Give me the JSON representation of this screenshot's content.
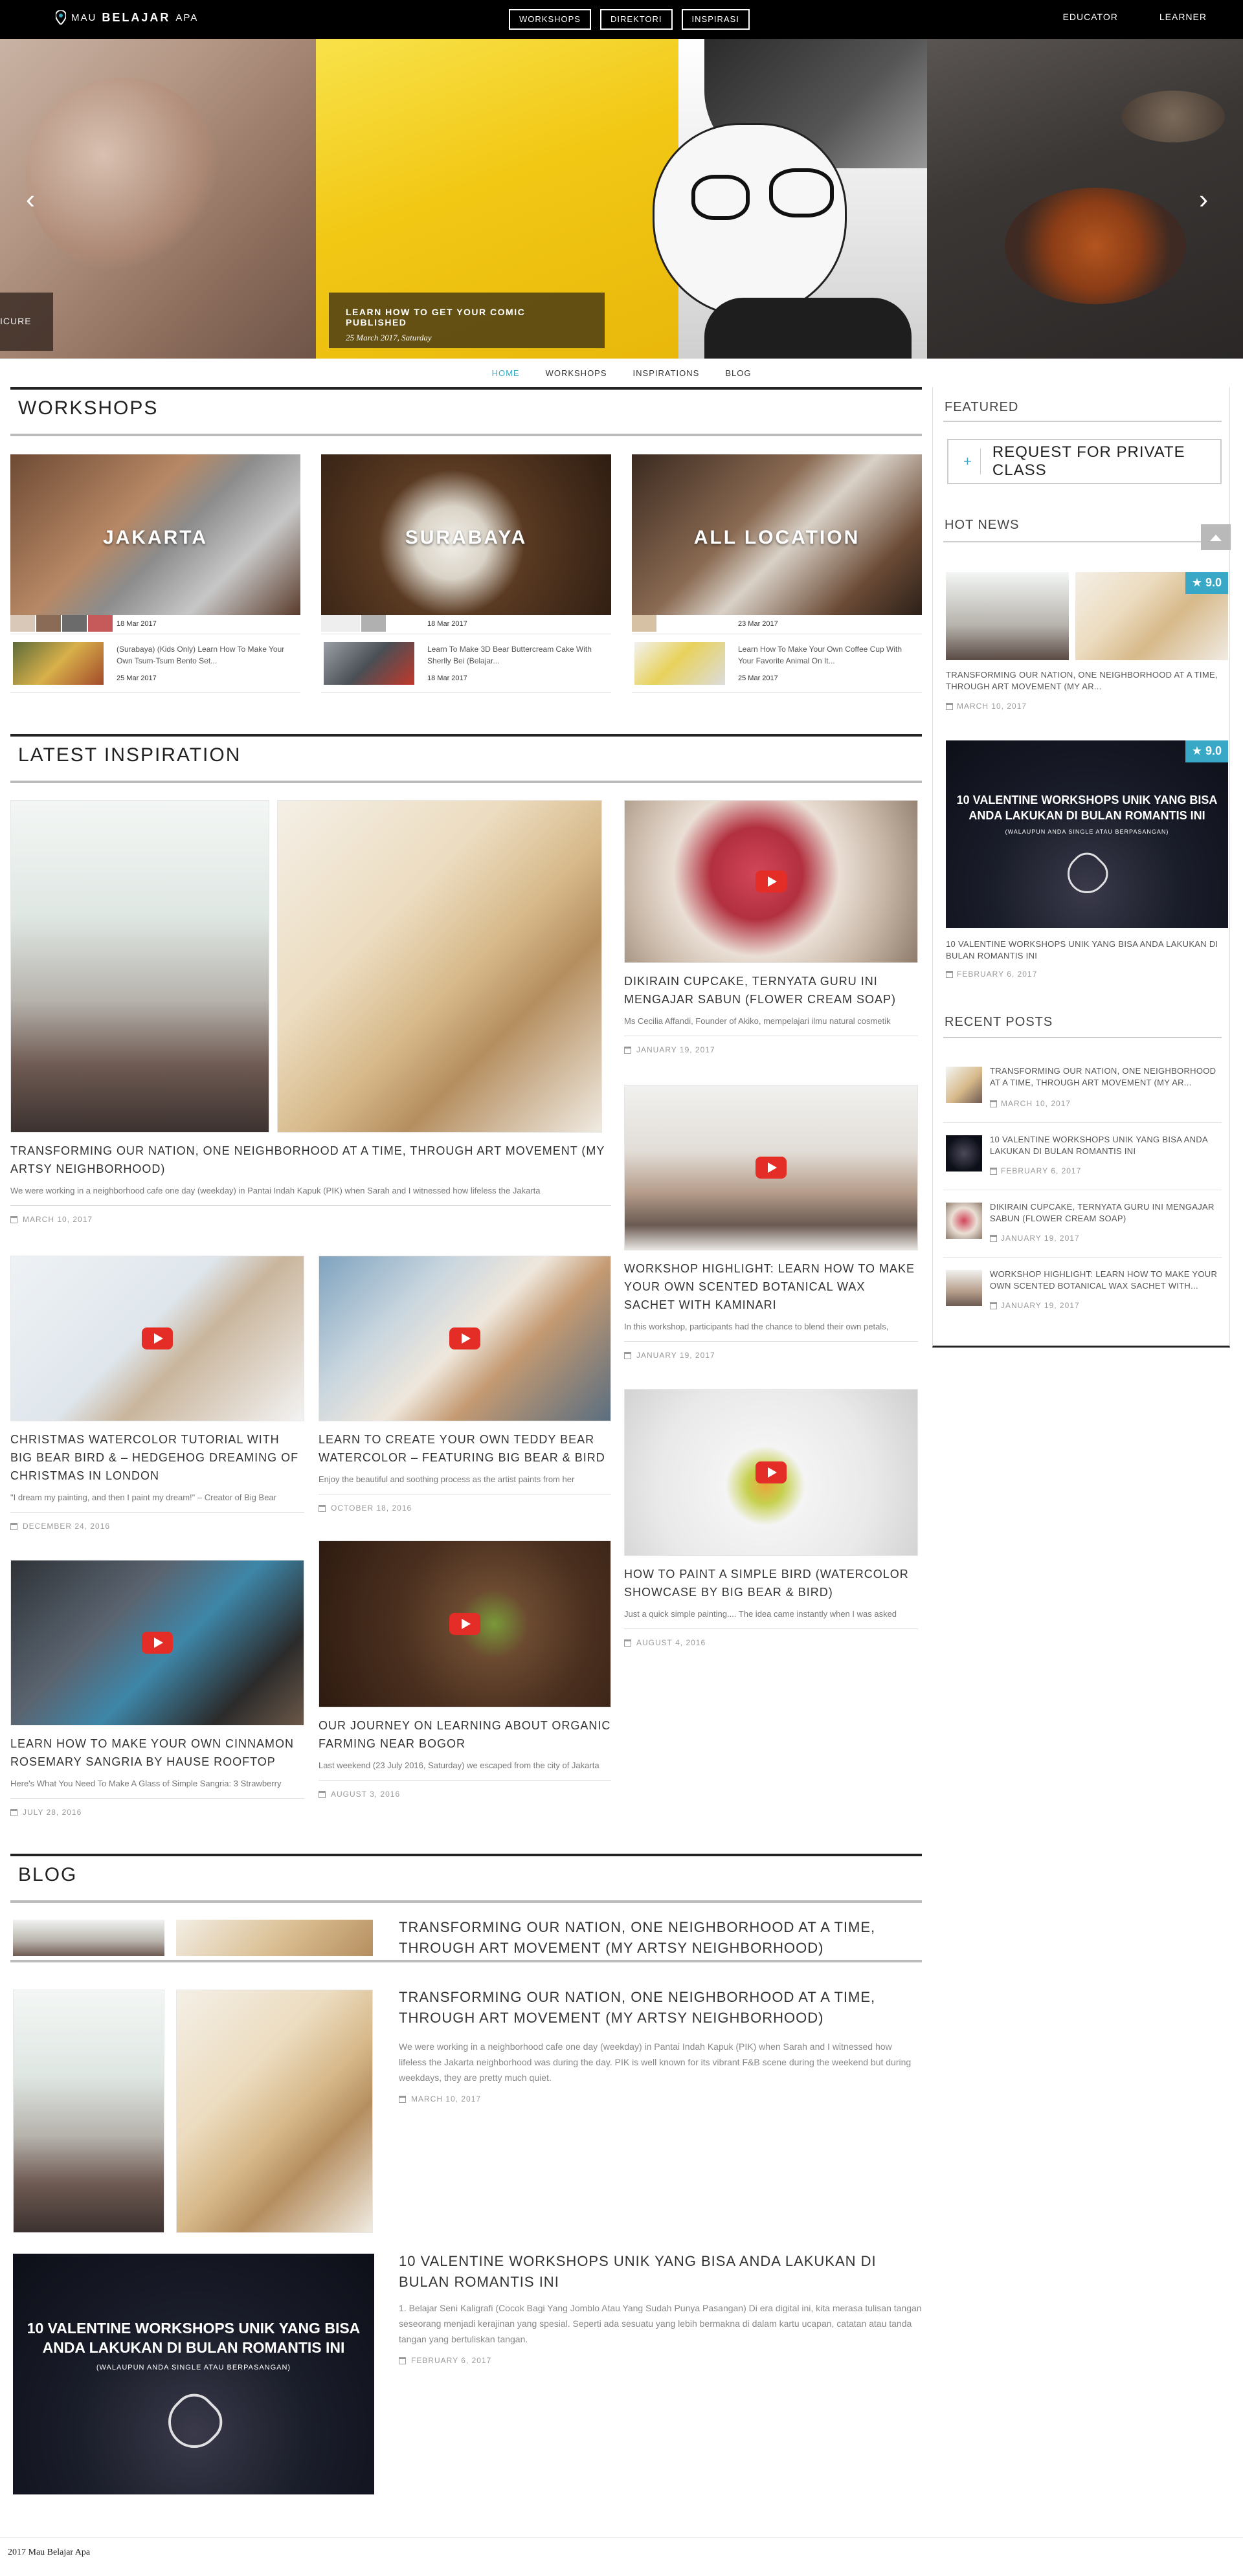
{
  "brand": {
    "logo_light": "MAU",
    "logo_bold": "BELAJAR",
    "logo_rest": "APA"
  },
  "top_nav": [
    {
      "label": "WORKSHOPS"
    },
    {
      "label": "DIREKTORI"
    },
    {
      "label": "INSPIRASI"
    }
  ],
  "top_right": [
    {
      "label": "EDUCATOR"
    },
    {
      "label": "LEARNER"
    }
  ],
  "hero": {
    "left_caption": "ICURE",
    "caption_title": "LEARN HOW TO GET YOUR COMIC PUBLISHED",
    "caption_date": "25 March 2017, Saturday",
    "prev_icon": "chevron-left-icon",
    "next_icon": "chevron-right-icon"
  },
  "sub_nav": [
    {
      "label": "HOME",
      "active": true
    },
    {
      "label": "WORKSHOPS"
    },
    {
      "label": "INSPIRATIONS"
    },
    {
      "label": "BLOG"
    }
  ],
  "workshops": {
    "heading": "WORKSHOPS",
    "cards": [
      {
        "city": "JAKARTA",
        "date": "18 Mar 2017",
        "item_text": "(Surabaya) (Kids Only) Learn How To Make Your Own Tsum-Tsum Bento Set...",
        "item_date": "25 Mar 2017"
      },
      {
        "city": "SURABAYA",
        "date": "18 Mar 2017",
        "item_text": "Learn To Make 3D Bear Buttercream Cake With Sherlly Bei (Belajar...",
        "item_date": "18 Mar 2017"
      },
      {
        "city": "ALL LOCATION",
        "date": "23 Mar 2017",
        "item_text": "Learn How To Make Your Own Coffee Cup With Your Favorite Animal On It...",
        "item_date": "25 Mar 2017"
      }
    ]
  },
  "inspiration": {
    "heading": "LATEST INSPIRATION",
    "items": [
      {
        "title": "TRANSFORMING OUR NATION, ONE NEIGHBORHOOD AT A TIME, THROUGH ART MOVEMENT (MY ARTSY NEIGHBORHOOD)",
        "excerpt": "We were working in a neighborhood cafe one day (weekday) in Pantai Indah Kapuk (PIK) when Sarah and I witnessed how lifeless the Jakarta",
        "date": "MARCH 10, 2017"
      },
      {
        "title": "DIKIRAIN CUPCAKE, TERNYATA GURU INI MENGAJAR SABUN (FLOWER CREAM SOAP)",
        "excerpt": "Ms Cecilia Affandi, Founder of Akiko, mempelajari ilmu natural cosmetik",
        "date": "JANUARY 19, 2017"
      },
      {
        "title": "WORKSHOP HIGHLIGHT: LEARN HOW TO MAKE YOUR OWN SCENTED BOTANICAL WAX SACHET WITH KAMINARI",
        "excerpt": "In this workshop, participants had the chance to blend their own petals,",
        "date": "JANUARY 19, 2017"
      },
      {
        "title": "CHRISTMAS WATERCOLOR TUTORIAL WITH BIG BEAR BIRD & – HEDGEHOG DREAMING OF CHRISTMAS IN LONDON",
        "excerpt": "\"I dream my painting, and then I paint my dream!\" – Creator of Big Bear",
        "date": "DECEMBER 24, 2016"
      },
      {
        "title": "LEARN TO CREATE YOUR OWN TEDDY BEAR WATERCOLOR – FEATURING BIG BEAR & BIRD",
        "excerpt": "Enjoy the beautiful and soothing process as the artist paints from her",
        "date": "OCTOBER 18, 2016"
      },
      {
        "title": "HOW TO PAINT A SIMPLE BIRD (WATERCOLOR SHOWCASE BY BIG BEAR & BIRD)",
        "excerpt": "Just a quick simple painting.... The idea came instantly when I was asked",
        "date": "AUGUST 4, 2016"
      },
      {
        "title": "LEARN HOW TO MAKE YOUR OWN CINNAMON ROSEMARY SANGRIA BY HAUSE ROOFTOP",
        "excerpt": "Here's What You Need To Make A Glass of Simple Sangria: 3 Strawberry",
        "date": "JULY 28, 2016"
      },
      {
        "title": "OUR JOURNEY ON LEARNING ABOUT ORGANIC FARMING NEAR BOGOR",
        "excerpt": "Last weekend (23 July 2016, Saturday) we escaped from the city of Jakarta",
        "date": "AUGUST 3, 2016"
      }
    ]
  },
  "blog": {
    "heading": "BLOG",
    "posts": [
      {
        "title": "TRANSFORMING OUR NATION, ONE NEIGHBORHOOD AT A TIME, THROUGH ART MOVEMENT (MY ARTSY NEIGHBORHOOD)"
      },
      {
        "title": "TRANSFORMING OUR NATION, ONE NEIGHBORHOOD AT A TIME, THROUGH ART MOVEMENT (MY ARTSY NEIGHBORHOOD)",
        "excerpt": "We were working in a neighborhood cafe one day (weekday) in Pantai Indah Kapuk (PIK) when Sarah and I witnessed how lifeless the Jakarta neighborhood was during the day. PIK is well known for its vibrant F&B scene during the weekend but during weekdays, they are pretty much quiet.",
        "date": "MARCH 10, 2017"
      },
      {
        "title": "10 VALENTINE WORKSHOPS UNIK YANG BISA ANDA LAKUKAN DI BULAN ROMANTIS INI",
        "excerpt": "1. Belajar Seni Kaligrafi (Cocok Bagi Yang Jomblo Atau Yang Sudah Punya Pasangan) Di era digital ini, kita merasa tulisan tangan seseorang menjadi kerajinan yang spesial. Seperti ada sesuatu yang lebih bermakna di dalam kartu ucapan, catatan atau tanda tangan yang bertuliskan tangan.",
        "date": "FEBRUARY 6, 2017",
        "img_line1": "10 VALENTINE WORKSHOPS UNIK YANG BISA",
        "img_line2": "ANDA LAKUKAN DI BULAN ROMANTIS INI",
        "img_sub": "(WALAUPUN ANDA SINGLE ATAU BERPASANGAN)"
      }
    ]
  },
  "sidebar": {
    "featured_heading": "FEATURED",
    "request_label": "REQUEST FOR PRIVATE CLASS",
    "hot_heading": "HOT NEWS",
    "hot_items": [
      {
        "rating": "9.0",
        "title": "TRANSFORMING OUR NATION, ONE NEIGHBORHOOD AT A TIME, THROUGH ART MOVEMENT (MY AR...",
        "date": "MARCH 10, 2017"
      },
      {
        "rating": "9.0",
        "title": "10 VALENTINE WORKSHOPS UNIK YANG BISA ANDA LAKUKAN DI BULAN ROMANTIS INI",
        "date": "FEBRUARY 6, 2017",
        "img_line1": "10 VALENTINE WORKSHOPS UNIK YANG BISA",
        "img_line2": "ANDA LAKUKAN DI BULAN ROMANTIS INI",
        "img_sub": "(WALAUPUN ANDA SINGLE ATAU BERPASANGAN)"
      }
    ],
    "recent_heading": "RECENT POSTS",
    "recent": [
      {
        "title": "TRANSFORMING OUR NATION, ONE NEIGHBORHOOD AT A TIME, THROUGH ART MOVEMENT (MY AR...",
        "date": "MARCH 10, 2017"
      },
      {
        "title": "10 VALENTINE WORKSHOPS UNIK YANG BISA ANDA LAKUKAN DI BULAN ROMANTIS INI",
        "date": "FEBRUARY 6, 2017"
      },
      {
        "title": "DIKIRAIN CUPCAKE, TERNYATA GURU INI MENGAJAR SABUN (FLOWER CREAM SOAP)",
        "date": "JANUARY 19, 2017"
      },
      {
        "title": "WORKSHOP HIGHLIGHT: LEARN HOW TO MAKE YOUR OWN SCENTED BOTANICAL WAX SACHET WITH...",
        "date": "JANUARY 19, 2017"
      }
    ]
  },
  "footer": {
    "text": "2017 Mau Belajar Apa"
  },
  "colors": {
    "accent": "#38a8c6",
    "topbar": "#000000",
    "youtube": "#e52d27"
  }
}
